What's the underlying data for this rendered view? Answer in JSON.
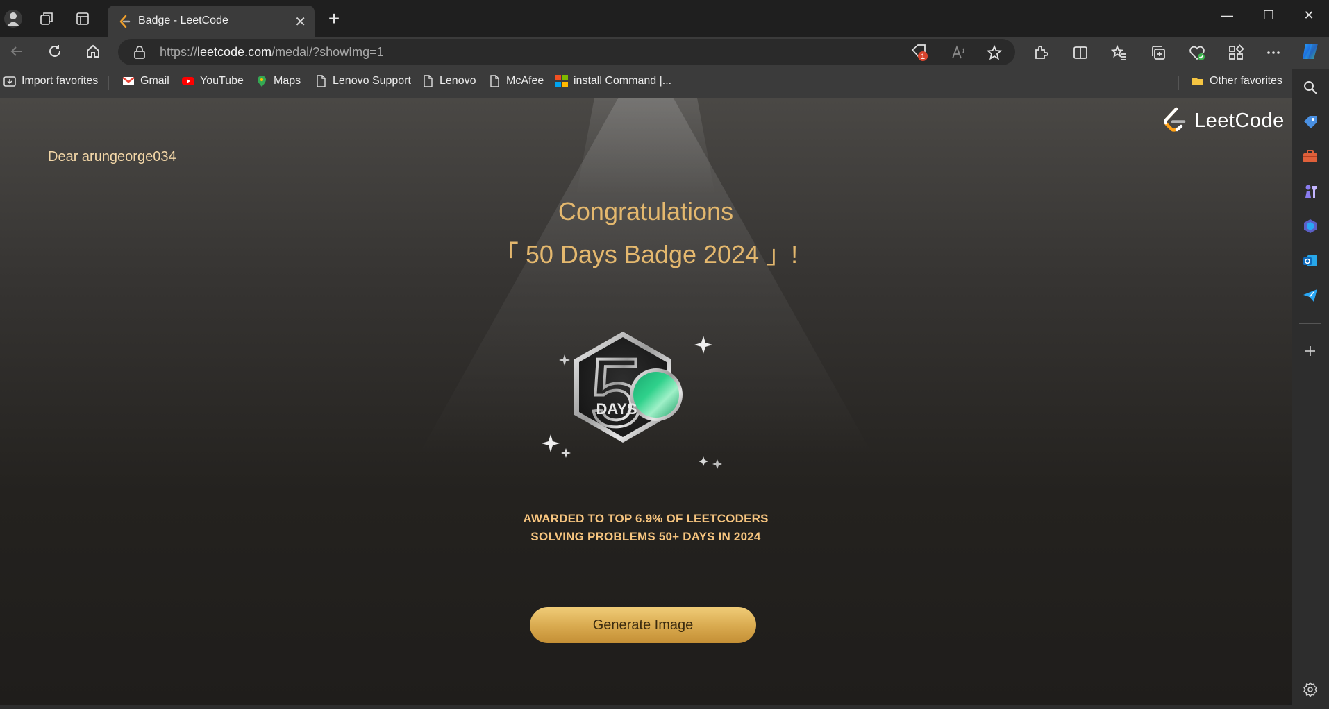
{
  "browser": {
    "tab": {
      "title": "Badge - LeetCode",
      "close": "✕"
    },
    "new_tab": "+",
    "window": {
      "minimize": "—",
      "maximize": "☐",
      "close": "✕"
    },
    "address": {
      "prefix": "https://",
      "domain": "leetcode.com",
      "path": "/medal/?showImg=1"
    },
    "notification_count": "1",
    "bookmarks": [
      {
        "label": "Import favorites",
        "icon": "import-icon"
      },
      {
        "label": "Gmail",
        "icon": "gmail-icon"
      },
      {
        "label": "YouTube",
        "icon": "youtube-icon"
      },
      {
        "label": "Maps",
        "icon": "maps-icon"
      },
      {
        "label": "Lenovo Support",
        "icon": "page-icon"
      },
      {
        "label": "Lenovo",
        "icon": "page-icon"
      },
      {
        "label": "McAfee",
        "icon": "page-icon"
      },
      {
        "label": "install Command |...",
        "icon": "microsoft-icon"
      },
      {
        "label": "Other favorites",
        "icon": "folder-icon"
      }
    ]
  },
  "page": {
    "logo_text": "LeetCode",
    "greeting": "Dear arungeorge034",
    "congrats_line1": "Congratulations",
    "congrats_line2": "「 50 Days Badge 2024 」!",
    "badge": {
      "number": "50",
      "unit": "DAYS"
    },
    "awarded_line1": "AWARDED TO TOP 6.9% OF LEETCODERS",
    "awarded_line2": "SOLVING PROBLEMS 50+ DAYS IN 2024",
    "generate_button": "Generate Image"
  },
  "colors": {
    "accent_gold": "#e4b86e",
    "button_gold": "#d8a94e",
    "badge_green": "#2fd18b"
  }
}
